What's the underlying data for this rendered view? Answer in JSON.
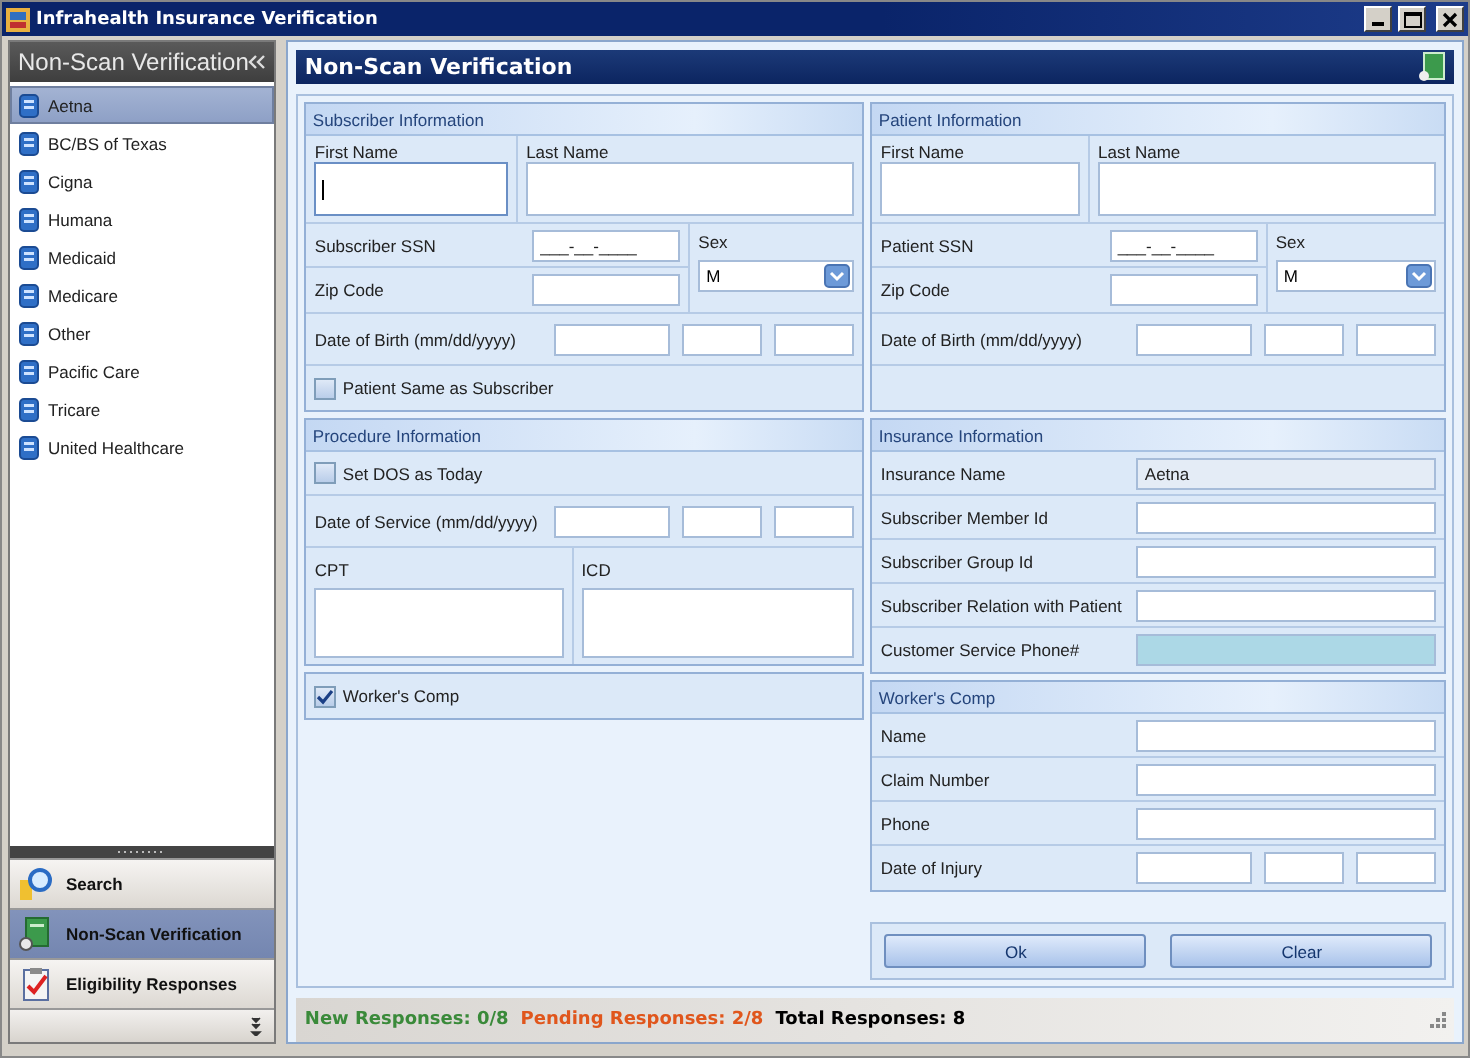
{
  "window": {
    "title": "Infrahealth Insurance Verification"
  },
  "nav": {
    "title": "Non-Scan Verification",
    "items": [
      {
        "label": "Aetna",
        "selected": true
      },
      {
        "label": "BC/BS of Texas",
        "selected": false
      },
      {
        "label": "Cigna",
        "selected": false
      },
      {
        "label": "Humana",
        "selected": false
      },
      {
        "label": "Medicaid",
        "selected": false
      },
      {
        "label": "Medicare",
        "selected": false
      },
      {
        "label": "Other",
        "selected": false
      },
      {
        "label": "Pacific Care",
        "selected": false
      },
      {
        "label": "Tricare",
        "selected": false
      },
      {
        "label": "United Healthcare",
        "selected": false
      }
    ]
  },
  "nav_buttons": [
    {
      "label": "Search",
      "kind": "search",
      "selected": false
    },
    {
      "label": "Non-Scan Verification",
      "kind": "document",
      "selected": true
    },
    {
      "label": "Eligibility Responses",
      "kind": "clipboard",
      "selected": false
    }
  ],
  "header": {
    "title": "Non-Scan Verification"
  },
  "subscriber": {
    "title": "Subscriber Information",
    "first_name": "First Name",
    "last_name": "Last Name",
    "ssn_label": "Subscriber SSN",
    "ssn_value": "___-__-____",
    "sex_label": "Sex",
    "sex_value": "M",
    "zip_label": "Zip Code",
    "dob_label": "Date of Birth (mm/dd/yyyy)",
    "focused": true,
    "same_as": {
      "label": "Patient Same as Subscriber",
      "checked": false
    }
  },
  "patient": {
    "title": "Patient Information",
    "first_name": "First Name",
    "last_name": "Last Name",
    "ssn_label": "Patient SSN",
    "ssn_value": "___-__-____",
    "sex_label": "Sex",
    "sex_value": "M",
    "zip_label": "Zip Code",
    "dob_label": "Date of Birth (mm/dd/yyyy)",
    "focused": false
  },
  "procedure": {
    "title": "Procedure Information",
    "set_dos": {
      "label": "Set DOS as Today",
      "checked": false
    },
    "dos_label": "Date of Service (mm/dd/yyyy)",
    "cpt_label": "CPT",
    "icd_label": "ICD"
  },
  "insurance": {
    "title": "Insurance Information",
    "fields": [
      {
        "label": "Insurance Name",
        "value": "Aetna",
        "kind": "readonly"
      },
      {
        "label": "Subscriber Member Id",
        "kind": "text"
      },
      {
        "label": "Subscriber Group Id",
        "kind": "text"
      },
      {
        "label": "Subscriber Relation with Patient",
        "kind": "text"
      },
      {
        "label": "Customer Service Phone#",
        "kind": "locked"
      }
    ]
  },
  "workers_comp_toggle": {
    "label": "Worker's Comp",
    "checked": true
  },
  "workers_comp": {
    "title": "Worker's Comp",
    "fields": [
      {
        "label": "Name",
        "kind": "text"
      },
      {
        "label": "Claim Number",
        "kind": "text"
      },
      {
        "label": "Phone",
        "kind": "text"
      },
      {
        "label": "Date of Injury",
        "kind": "date"
      }
    ]
  },
  "buttons": [
    {
      "label": "Ok"
    },
    {
      "label": "Clear"
    }
  ],
  "status": [
    {
      "text": "New Responses: 0/8",
      "color": "#3a8a3a"
    },
    {
      "text": "Pending Responses: 2/8",
      "color": "#e0561c"
    },
    {
      "text": "Total Responses: 8",
      "color": "#000000"
    }
  ]
}
